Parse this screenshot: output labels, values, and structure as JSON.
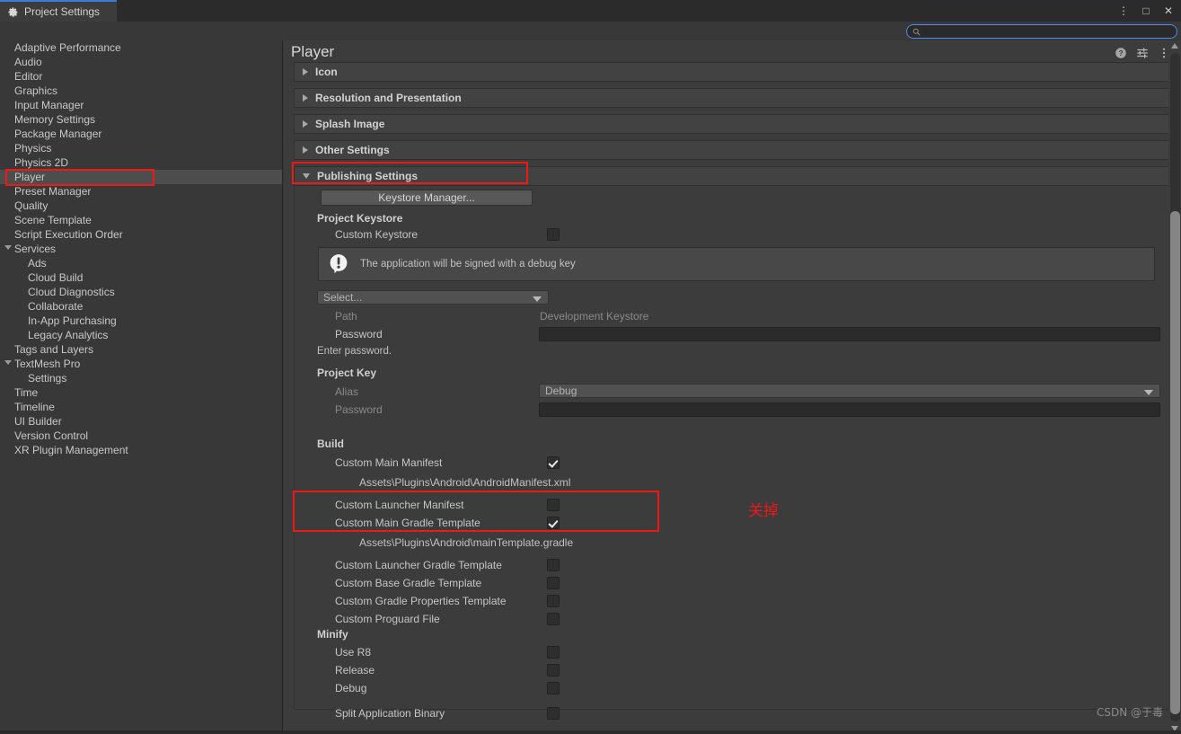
{
  "window": {
    "tab_label": "Project Settings",
    "tab_icon": "gear-icon",
    "controls": [
      {
        "name": "kebab-menu-icon",
        "glyph": "⋮"
      },
      {
        "name": "maximize-icon",
        "glyph": "□"
      },
      {
        "name": "close-icon",
        "glyph": "✕"
      }
    ]
  },
  "search": {
    "value": "",
    "placeholder": "",
    "icon": "search-icon",
    "focus_color": "#4a8df0"
  },
  "sidebar": {
    "items": [
      {
        "label": "Adaptive Performance",
        "level": 0,
        "expandable": false,
        "selected": false
      },
      {
        "label": "Audio",
        "level": 0,
        "expandable": false,
        "selected": false
      },
      {
        "label": "Editor",
        "level": 0,
        "expandable": false,
        "selected": false
      },
      {
        "label": "Graphics",
        "level": 0,
        "expandable": false,
        "selected": false
      },
      {
        "label": "Input Manager",
        "level": 0,
        "expandable": false,
        "selected": false
      },
      {
        "label": "Memory Settings",
        "level": 0,
        "expandable": false,
        "selected": false
      },
      {
        "label": "Package Manager",
        "level": 0,
        "expandable": false,
        "selected": false
      },
      {
        "label": "Physics",
        "level": 0,
        "expandable": false,
        "selected": false
      },
      {
        "label": "Physics 2D",
        "level": 0,
        "expandable": false,
        "selected": false
      },
      {
        "label": "Player",
        "level": 0,
        "expandable": false,
        "selected": true
      },
      {
        "label": "Preset Manager",
        "level": 0,
        "expandable": false,
        "selected": false
      },
      {
        "label": "Quality",
        "level": 0,
        "expandable": false,
        "selected": false
      },
      {
        "label": "Scene Template",
        "level": 0,
        "expandable": false,
        "selected": false
      },
      {
        "label": "Script Execution Order",
        "level": 0,
        "expandable": false,
        "selected": false
      },
      {
        "label": "Services",
        "level": 0,
        "expandable": true,
        "selected": false
      },
      {
        "label": "Ads",
        "level": 1,
        "expandable": false,
        "selected": false
      },
      {
        "label": "Cloud Build",
        "level": 1,
        "expandable": false,
        "selected": false
      },
      {
        "label": "Cloud Diagnostics",
        "level": 1,
        "expandable": false,
        "selected": false
      },
      {
        "label": "Collaborate",
        "level": 1,
        "expandable": false,
        "selected": false
      },
      {
        "label": "In-App Purchasing",
        "level": 1,
        "expandable": false,
        "selected": false
      },
      {
        "label": "Legacy Analytics",
        "level": 1,
        "expandable": false,
        "selected": false
      },
      {
        "label": "Tags and Layers",
        "level": 0,
        "expandable": false,
        "selected": false
      },
      {
        "label": "TextMesh Pro",
        "level": 0,
        "expandable": true,
        "selected": false
      },
      {
        "label": "Settings",
        "level": 1,
        "expandable": false,
        "selected": false
      },
      {
        "label": "Time",
        "level": 0,
        "expandable": false,
        "selected": false
      },
      {
        "label": "Timeline",
        "level": 0,
        "expandable": false,
        "selected": false
      },
      {
        "label": "UI Builder",
        "level": 0,
        "expandable": false,
        "selected": false
      },
      {
        "label": "Version Control",
        "level": 0,
        "expandable": false,
        "selected": false
      },
      {
        "label": "XR Plugin Management",
        "level": 0,
        "expandable": false,
        "selected": false
      }
    ]
  },
  "panel": {
    "title": "Player",
    "icons": [
      {
        "name": "help-icon",
        "glyph": "?"
      },
      {
        "name": "preset-settings-icon",
        "glyph": "sliders"
      },
      {
        "name": "panel-kebab-icon",
        "glyph": "⋮"
      }
    ],
    "foldouts": [
      {
        "label": "Icon",
        "expanded": false
      },
      {
        "label": "Resolution and Presentation",
        "expanded": false
      },
      {
        "label": "Splash Image",
        "expanded": false
      },
      {
        "label": "Other Settings",
        "expanded": false
      },
      {
        "label": "Publishing Settings",
        "expanded": true
      }
    ]
  },
  "publishing": {
    "keystore_manager_button": "Keystore Manager...",
    "project_keystore": {
      "header": "Project Keystore",
      "custom_keystore_label": "Custom Keystore",
      "custom_keystore_checked": false,
      "warning_text": "The application will be signed with a debug key",
      "warning_icon": "warning-icon",
      "select_dropdown_value": "Select...",
      "path_label": "Path",
      "path_value": "Development Keystore",
      "password_label": "Password",
      "password_value": "",
      "password_hint": "Enter password."
    },
    "project_key": {
      "header": "Project Key",
      "alias_label": "Alias",
      "alias_value": "Debug",
      "password_label": "Password",
      "password_value": ""
    },
    "build": {
      "header": "Build",
      "rows": [
        {
          "label": "Custom Main Manifest",
          "checked": true,
          "path": "Assets\\Plugins\\Android\\AndroidManifest.xml"
        },
        {
          "label": "Custom Launcher Manifest",
          "checked": false,
          "path": null
        },
        {
          "label": "Custom Main Gradle Template",
          "checked": true,
          "path": "Assets\\Plugins\\Android\\mainTemplate.gradle"
        },
        {
          "label": "Custom Launcher Gradle Template",
          "checked": false,
          "path": null
        },
        {
          "label": "Custom Base Gradle Template",
          "checked": false,
          "path": null
        },
        {
          "label": "Custom Gradle Properties Template",
          "checked": false,
          "path": null
        },
        {
          "label": "Custom Proguard File",
          "checked": false,
          "path": null
        }
      ]
    },
    "minify": {
      "header": "Minify",
      "rows": [
        {
          "label": "Use R8",
          "checked": false
        },
        {
          "label": "Release",
          "checked": false
        },
        {
          "label": "Debug",
          "checked": false
        }
      ],
      "split_label": "Split Application Binary",
      "split_checked": false
    }
  },
  "annotations": {
    "color": "#f01717",
    "note_text": "关掉",
    "boxes": [
      {
        "name": "player-sidebar-highlight"
      },
      {
        "name": "publishing-settings-highlight"
      },
      {
        "name": "custom-main-gradle-highlight"
      }
    ]
  },
  "watermark": "CSDN @于毒",
  "scrollbar": {
    "orientation": "vertical",
    "position_pct": 24
  }
}
